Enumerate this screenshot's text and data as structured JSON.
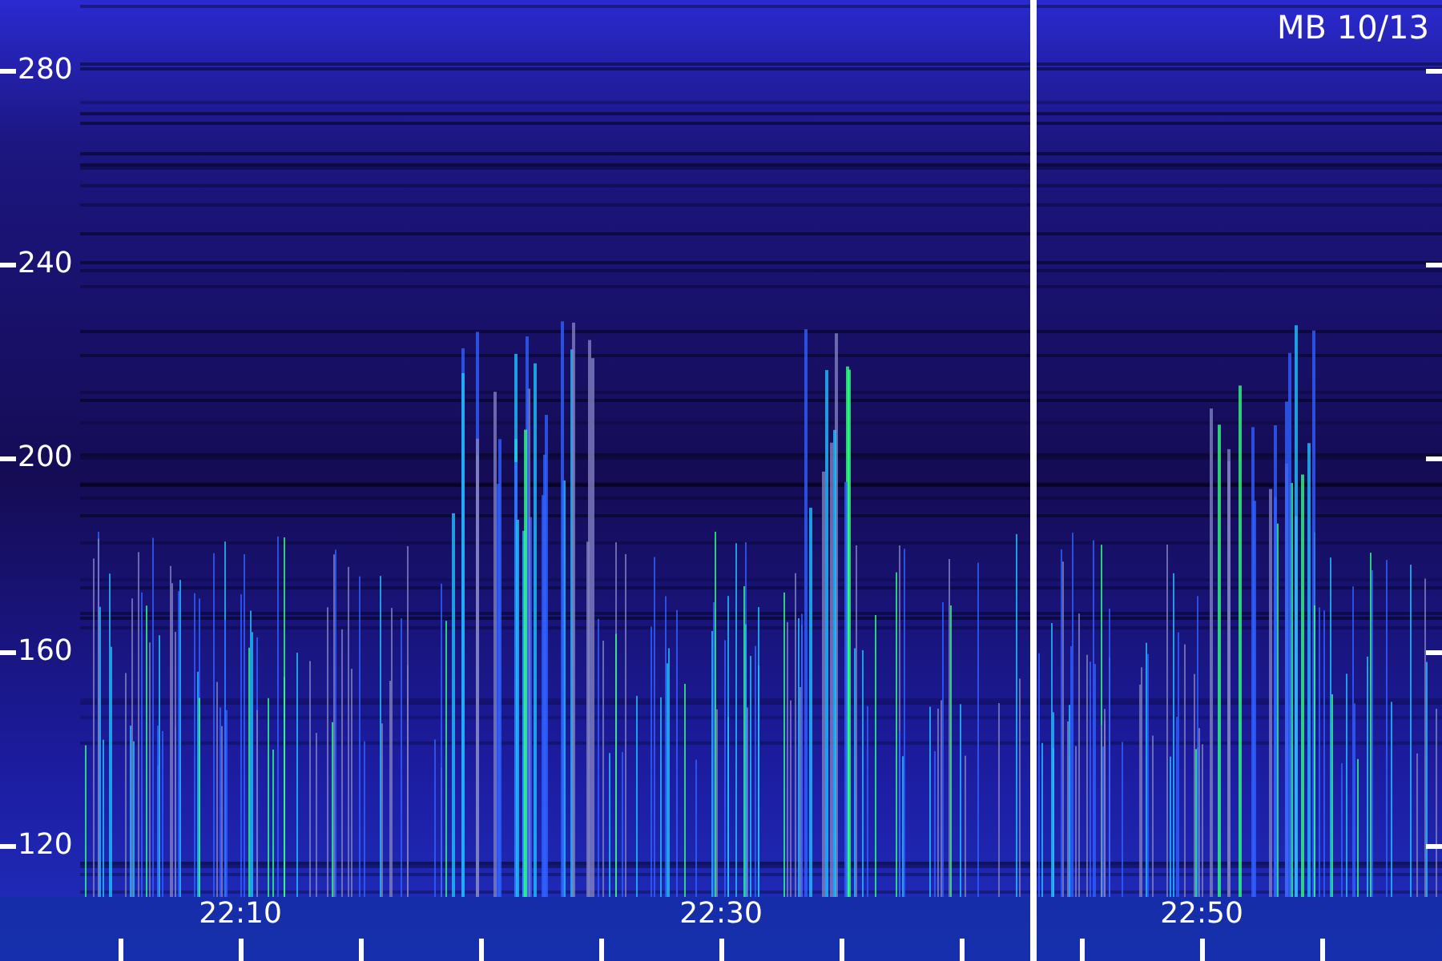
{
  "title": "MB 10/13",
  "y_axis": {
    "labels": [
      "280",
      "240",
      "200",
      "160",
      "120"
    ]
  },
  "x_axis": {
    "labels": [
      "22:10",
      "22:30",
      "22:50"
    ]
  }
}
